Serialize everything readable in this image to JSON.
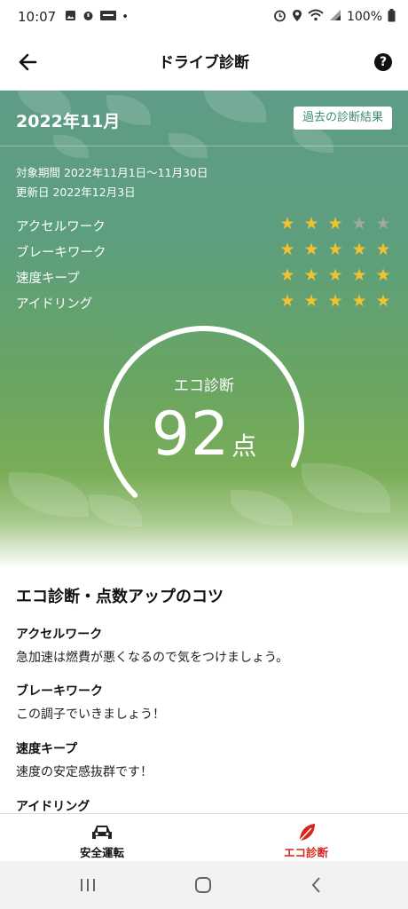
{
  "status_bar": {
    "time": "10:07",
    "battery": "100%"
  },
  "app_bar": {
    "title": "ドライブ診断",
    "help_symbol": "?"
  },
  "summary": {
    "month": "2022年11月",
    "history_button": "過去の診断結果",
    "period": "対象期間 2022年11月1日〜11月30日",
    "updated": "更新日 2022年12月3日",
    "ratings": [
      {
        "label": "アクセルワーク",
        "stars": 3,
        "max": 5
      },
      {
        "label": "ブレーキワーク",
        "stars": 5,
        "max": 5
      },
      {
        "label": "速度キープ",
        "stars": 5,
        "max": 5
      },
      {
        "label": "アイドリング",
        "stars": 5,
        "max": 5
      }
    ],
    "gauge": {
      "label": "エコ診断",
      "score": "92",
      "unit": "点",
      "score_value": 92,
      "max_value": 100
    }
  },
  "tips": {
    "title": "エコ診断・点数アップのコツ",
    "items": [
      {
        "heading": "アクセルワーク",
        "body": "急加速は燃費が悪くなるので気をつけましょう。"
      },
      {
        "heading": "ブレーキワーク",
        "body": "この調子でいきましょう！"
      },
      {
        "heading": "速度キープ",
        "body": "速度の安定感抜群です！"
      },
      {
        "heading": "アイドリング",
        "body": ""
      }
    ]
  },
  "bottom_nav": {
    "items": [
      {
        "label": "安全運転",
        "icon": "car-icon",
        "active": false
      },
      {
        "label": "エコ診断",
        "icon": "leaf-icon",
        "active": true
      }
    ],
    "active_color": "#d7261e"
  },
  "theme": {
    "star_on": "#f2c230",
    "star_off": "#a3a7a1",
    "accent_green": "#3f8a72"
  }
}
